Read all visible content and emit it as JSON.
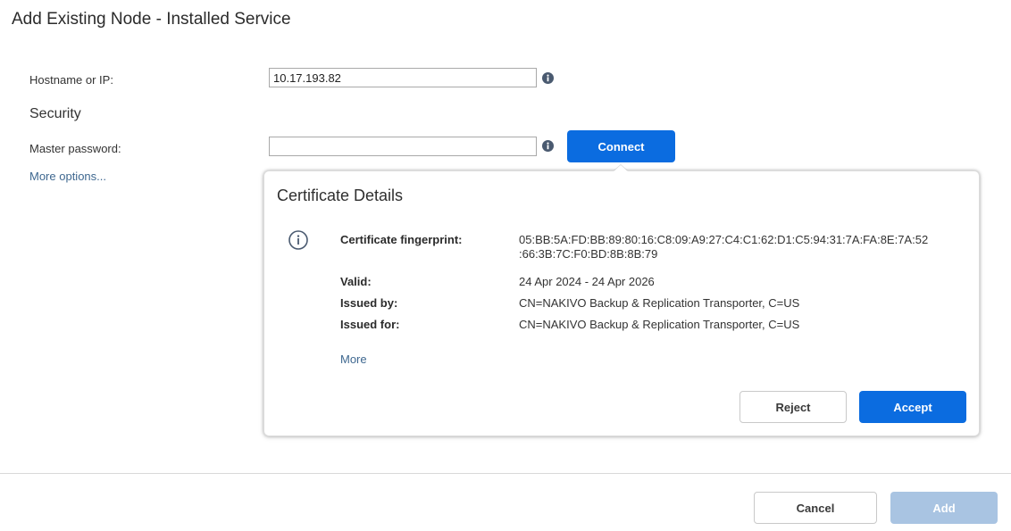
{
  "dialog": {
    "title": "Add Existing Node - Installed Service"
  },
  "form": {
    "hostname_label": "Hostname or IP:",
    "hostname_value": "10.17.193.82",
    "security_heading": "Security",
    "password_label": "Master password:",
    "password_value": "",
    "connect_label": "Connect",
    "more_options_label": "More options..."
  },
  "certificate": {
    "title": "Certificate Details",
    "fingerprint_label": "Certificate fingerprint:",
    "fingerprint_line1": "05:BB:5A:FD:BB:89:80:16:C8:09:A9:27:C4:C1:62:D1:C5:94:31:7A:FA:8E:7A:52",
    "fingerprint_line2": ":66:3B:7C:F0:BD:8B:8B:79",
    "valid_label": "Valid:",
    "valid_value": "24 Apr 2024 - 24 Apr 2026",
    "issued_by_label": "Issued by:",
    "issued_by_value": "CN=NAKIVO Backup & Replication Transporter, C=US",
    "issued_for_label": "Issued for:",
    "issued_for_value": "CN=NAKIVO Backup & Replication Transporter, C=US",
    "more_label": "More",
    "reject_label": "Reject",
    "accept_label": "Accept"
  },
  "footer": {
    "cancel_label": "Cancel",
    "add_label": "Add"
  },
  "icons": {
    "hostname_info": "info-icon",
    "password_info": "info-icon",
    "certificate": "info-outline-icon"
  },
  "colors": {
    "primary": "#0b6ce0",
    "primary_disabled": "#a9c4e2",
    "link": "#3f6890"
  }
}
